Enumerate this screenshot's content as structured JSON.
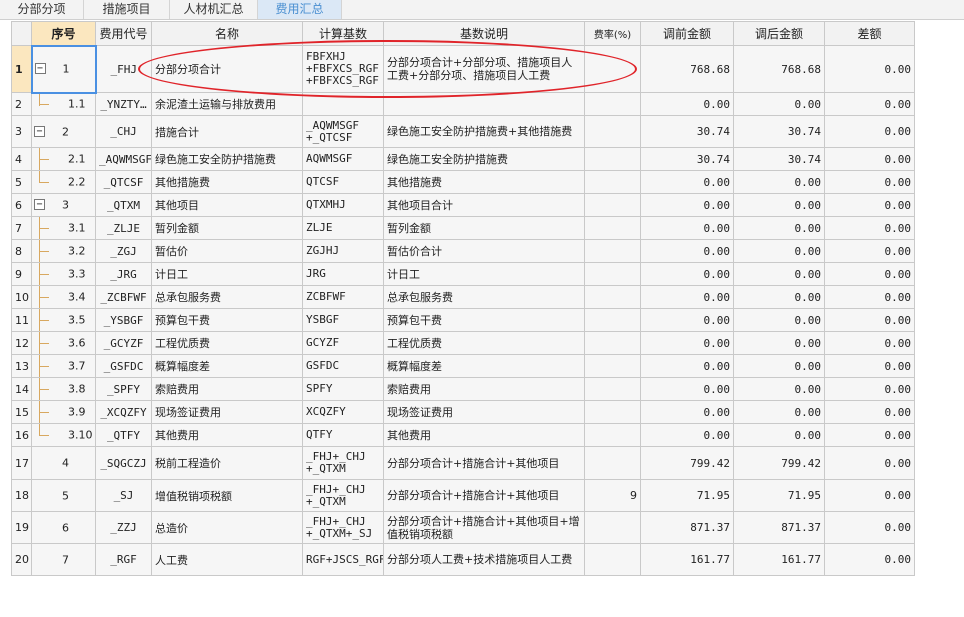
{
  "tabs": [
    {
      "label": "分部分项"
    },
    {
      "label": "措施项目"
    },
    {
      "label": "人材机汇总"
    },
    {
      "label": "费用汇总"
    }
  ],
  "grid": {
    "headers": {
      "seq": "序号",
      "code": "费用代号",
      "name": "名称",
      "base": "计算基数",
      "desc": "基数说明",
      "rate": "费率(%)",
      "before": "调前金额",
      "after": "调后金额",
      "diff": "差额"
    },
    "rows": [
      {
        "rn": "1",
        "seq": "1",
        "code": "_FHJ",
        "name": "分部分项合计",
        "base": "FBFXHJ\n+FBFXCS_RGF\n+FBFXCS_RGF",
        "desc": "分部分项合计+分部分项、措施项目人工费+分部分项、措施项目人工费",
        "rate": "",
        "before": "768.68",
        "after": "768.68",
        "diff": "0.00"
      },
      {
        "rn": "2",
        "seq": "1.1",
        "code": "_YNZTY…",
        "name": "余泥渣土运输与排放费用",
        "base": "",
        "desc": "",
        "rate": "",
        "before": "0.00",
        "after": "0.00",
        "diff": "0.00"
      },
      {
        "rn": "3",
        "seq": "2",
        "code": "_CHJ",
        "name": "措施合计",
        "base": "_AQWMSGF\n+_QTCSF",
        "desc": "绿色施工安全防护措施费+其他措施费",
        "rate": "",
        "before": "30.74",
        "after": "30.74",
        "diff": "0.00"
      },
      {
        "rn": "4",
        "seq": "2.1",
        "code": "_AQWMSGF",
        "name": "绿色施工安全防护措施费",
        "base": "AQWMSGF",
        "desc": "绿色施工安全防护措施费",
        "rate": "",
        "before": "30.74",
        "after": "30.74",
        "diff": "0.00"
      },
      {
        "rn": "5",
        "seq": "2.2",
        "code": "_QTCSF",
        "name": "其他措施费",
        "base": "QTCSF",
        "desc": "其他措施费",
        "rate": "",
        "before": "0.00",
        "after": "0.00",
        "diff": "0.00"
      },
      {
        "rn": "6",
        "seq": "3",
        "code": "_QTXM",
        "name": "其他项目",
        "base": "QTXMHJ",
        "desc": "其他项目合计",
        "rate": "",
        "before": "0.00",
        "after": "0.00",
        "diff": "0.00"
      },
      {
        "rn": "7",
        "seq": "3.1",
        "code": "_ZLJE",
        "name": "暂列金额",
        "base": "ZLJE",
        "desc": "暂列金额",
        "rate": "",
        "before": "0.00",
        "after": "0.00",
        "diff": "0.00"
      },
      {
        "rn": "8",
        "seq": "3.2",
        "code": "_ZGJ",
        "name": "暂估价",
        "base": "ZGJHJ",
        "desc": "暂估价合计",
        "rate": "",
        "before": "0.00",
        "after": "0.00",
        "diff": "0.00"
      },
      {
        "rn": "9",
        "seq": "3.3",
        "code": "_JRG",
        "name": "计日工",
        "base": "JRG",
        "desc": "计日工",
        "rate": "",
        "before": "0.00",
        "after": "0.00",
        "diff": "0.00"
      },
      {
        "rn": "10",
        "seq": "3.4",
        "code": "_ZCBFWF",
        "name": "总承包服务费",
        "base": "ZCBFWF",
        "desc": "总承包服务费",
        "rate": "",
        "before": "0.00",
        "after": "0.00",
        "diff": "0.00"
      },
      {
        "rn": "11",
        "seq": "3.5",
        "code": "_YSBGF",
        "name": "预算包干费",
        "base": "YSBGF",
        "desc": "预算包干费",
        "rate": "",
        "before": "0.00",
        "after": "0.00",
        "diff": "0.00"
      },
      {
        "rn": "12",
        "seq": "3.6",
        "code": "_GCYZF",
        "name": "工程优质费",
        "base": "GCYZF",
        "desc": "工程优质费",
        "rate": "",
        "before": "0.00",
        "after": "0.00",
        "diff": "0.00"
      },
      {
        "rn": "13",
        "seq": "3.7",
        "code": "_GSFDC",
        "name": "概算幅度差",
        "base": "GSFDC",
        "desc": "概算幅度差",
        "rate": "",
        "before": "0.00",
        "after": "0.00",
        "diff": "0.00"
      },
      {
        "rn": "14",
        "seq": "3.8",
        "code": "_SPFY",
        "name": "索赔费用",
        "base": "SPFY",
        "desc": "索赔费用",
        "rate": "",
        "before": "0.00",
        "after": "0.00",
        "diff": "0.00"
      },
      {
        "rn": "15",
        "seq": "3.9",
        "code": "_XCQZFY",
        "name": "现场签证费用",
        "base": "XCQZFY",
        "desc": "现场签证费用",
        "rate": "",
        "before": "0.00",
        "after": "0.00",
        "diff": "0.00"
      },
      {
        "rn": "16",
        "seq": "3.10",
        "code": "_QTFY",
        "name": "其他费用",
        "base": "QTFY",
        "desc": "其他费用",
        "rate": "",
        "before": "0.00",
        "after": "0.00",
        "diff": "0.00"
      },
      {
        "rn": "17",
        "seq": "4",
        "code": "_SQGCZJ",
        "name": "税前工程造价",
        "base": "_FHJ+_CHJ\n+_QTXM",
        "desc": "分部分项合计+措施合计+其他项目",
        "rate": "",
        "before": "799.42",
        "after": "799.42",
        "diff": "0.00"
      },
      {
        "rn": "18",
        "seq": "5",
        "code": "_SJ",
        "name": "增值税销项税额",
        "base": "_FHJ+_CHJ\n+_QTXM",
        "desc": "分部分项合计+措施合计+其他项目",
        "rate": "9",
        "before": "71.95",
        "after": "71.95",
        "diff": "0.00"
      },
      {
        "rn": "19",
        "seq": "6",
        "code": "_ZZJ",
        "name": "总造价",
        "base": "_FHJ+_CHJ\n+_QTXM+_SJ",
        "desc": "分部分项合计+措施合计+其他项目+增值税销项税额",
        "rate": "",
        "before": "871.37",
        "after": "871.37",
        "diff": "0.00"
      },
      {
        "rn": "20",
        "seq": "7",
        "code": "_RGF",
        "name": "人工费",
        "base": "RGF+JSCS_RGF",
        "desc": "分部分项人工费+技术措施项目人工费",
        "rate": "",
        "before": "161.77",
        "after": "161.77",
        "diff": "0.00"
      }
    ]
  },
  "colors": {
    "highlight_ring": "#e0242a",
    "active_tab_text": "#4a8fd1",
    "selected_header": "#fbe7bf"
  }
}
